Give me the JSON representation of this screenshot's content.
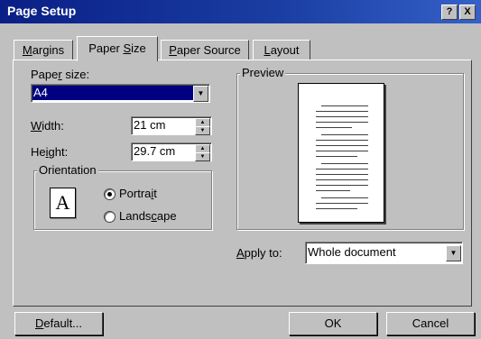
{
  "window": {
    "title": "Page Setup",
    "help_button": "?",
    "close_button": "X"
  },
  "tabs": [
    {
      "label_pre": "",
      "label_key": "M",
      "label_post": "argins"
    },
    {
      "label_pre": "Paper ",
      "label_key": "S",
      "label_post": "ize"
    },
    {
      "label_pre": "",
      "label_key": "P",
      "label_post": "aper Source"
    },
    {
      "label_pre": "",
      "label_key": "L",
      "label_post": "ayout"
    }
  ],
  "paper_size": {
    "label_pre": "Pape",
    "label_key": "r",
    "label_post": " size:",
    "value": "A4"
  },
  "width": {
    "label_pre": "",
    "label_key": "W",
    "label_post": "idth:",
    "value": "21 cm"
  },
  "height": {
    "label_pre": "He",
    "label_key": "i",
    "label_post": "ght:",
    "value": "29.7 cm"
  },
  "orientation": {
    "title": "Orientation",
    "icon_letter": "A",
    "portrait": {
      "label_pre": "Portra",
      "label_key": "i",
      "label_post": "t",
      "selected": true
    },
    "landscape": {
      "label_pre": "Lands",
      "label_key": "c",
      "label_post": "ape",
      "selected": false
    }
  },
  "preview": {
    "title": "Preview"
  },
  "apply_to": {
    "label_pre": "",
    "label_key": "A",
    "label_post": "pply to:",
    "value": "Whole document"
  },
  "buttons": {
    "default_pre": "",
    "default_key": "D",
    "default_post": "efault...",
    "ok": "OK",
    "cancel": "Cancel"
  }
}
